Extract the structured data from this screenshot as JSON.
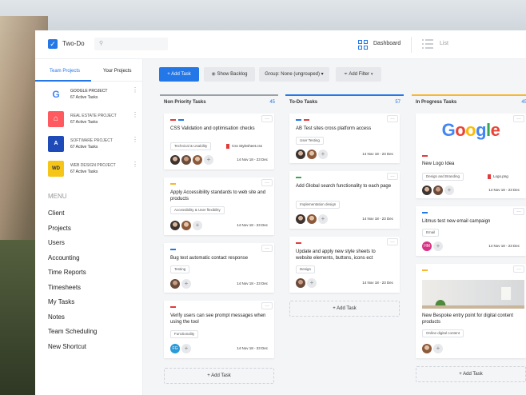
{
  "app": {
    "title": "Two-Do"
  },
  "search": {
    "placeholder": ""
  },
  "nav": {
    "dashboard": "Dashboard",
    "list": "List"
  },
  "sidebar": {
    "tabs": [
      "Team Projects",
      "Your Projects"
    ],
    "projects": [
      {
        "name": "GOOGLE PROJECT",
        "tasks": "67 Active Tasks",
        "icon": "G",
        "color": "#ffffff"
      },
      {
        "name": "REAL ESTATE PROJECT",
        "tasks": "67 Active Tasks",
        "icon": "airbnb-icon",
        "color": "#ff5a5f"
      },
      {
        "name": "SOFTWARE PROJECT",
        "tasks": "67 Active Tasks",
        "icon": "A",
        "color": "#1f4bb8"
      },
      {
        "name": "WEB DESIGN PROJECT",
        "tasks": "67 Active Tasks",
        "icon": "WD",
        "color": "#f5c518"
      }
    ],
    "menu_title": "MENU",
    "menu": [
      "Client",
      "Projects",
      "Users",
      "Accounting",
      "Time Reports",
      "Timesheets",
      "My Tasks",
      "Notes",
      "Team Scheduling",
      "New Shortcut"
    ]
  },
  "toolbar": {
    "add_task": "+ Add Task",
    "backlog": "Show Backlog",
    "group": "Group: None (ungrouped)",
    "filter": "Add Filter"
  },
  "columns": [
    {
      "title": "Non Priority Tasks",
      "count": "45",
      "color": "#9aa0a6",
      "cards": [
        {
          "title": "CSS Validation and optimisation checks",
          "tag": "Technical & Usability",
          "attachment": "Css Stylesheet.css",
          "dates": "14 Nov 18 - 23 Dec"
        },
        {
          "title": "Apply Accessibility standards to web site and products",
          "tag": "Accessibility & User flexibility",
          "dates": "14 Nov 18 - 23 Dec"
        },
        {
          "title": "Bug test automatic contact response",
          "tag": "Testing",
          "dates": "14 Nov 18 - 23 Dec"
        },
        {
          "title": "Verify users can see prompt messages when using the tool",
          "tag": "Functionality",
          "avatar_text": "FG",
          "dates": "14 Nov 18 - 23 Dec"
        }
      ],
      "add": "+ Add Task"
    },
    {
      "title": "To-Do Tasks",
      "count": "57",
      "color": "#2477e6",
      "cards": [
        {
          "title": "AB Test sites cross platform access",
          "tag": "User Testing",
          "dates": "14 Nov 18 - 23 Dec"
        },
        {
          "title": "Add Global search functionality to each page",
          "tag": "Implementation design",
          "dates": "14 Nov 18 - 23 Dec"
        },
        {
          "title": "Update and apply new style sheets to website elements, buttons, icons ect",
          "tag": "Design",
          "dates": "14 Nov 18 - 23 Dec"
        }
      ],
      "add": "+ Add Task"
    },
    {
      "title": "In Progress Tasks",
      "count": "45",
      "color": "#f5b82e",
      "cards": [
        {
          "brand": "Google",
          "title": "New Logo Idea",
          "tag": "Design and Branding",
          "attachment": "Logo.png",
          "dates": "14 Nov 18 - 23 Dec"
        },
        {
          "title": "Litmus test new email campaign",
          "tag": "Email",
          "avatar_text": "HM",
          "dates": "14 Nov 18 - 23 Dec"
        },
        {
          "title": "New Bespoke entry point for digital content products",
          "tag": "Online digital content",
          "dates": "14 Nov 18 - 23 Dec"
        }
      ],
      "add": "+ Add Task"
    }
  ]
}
